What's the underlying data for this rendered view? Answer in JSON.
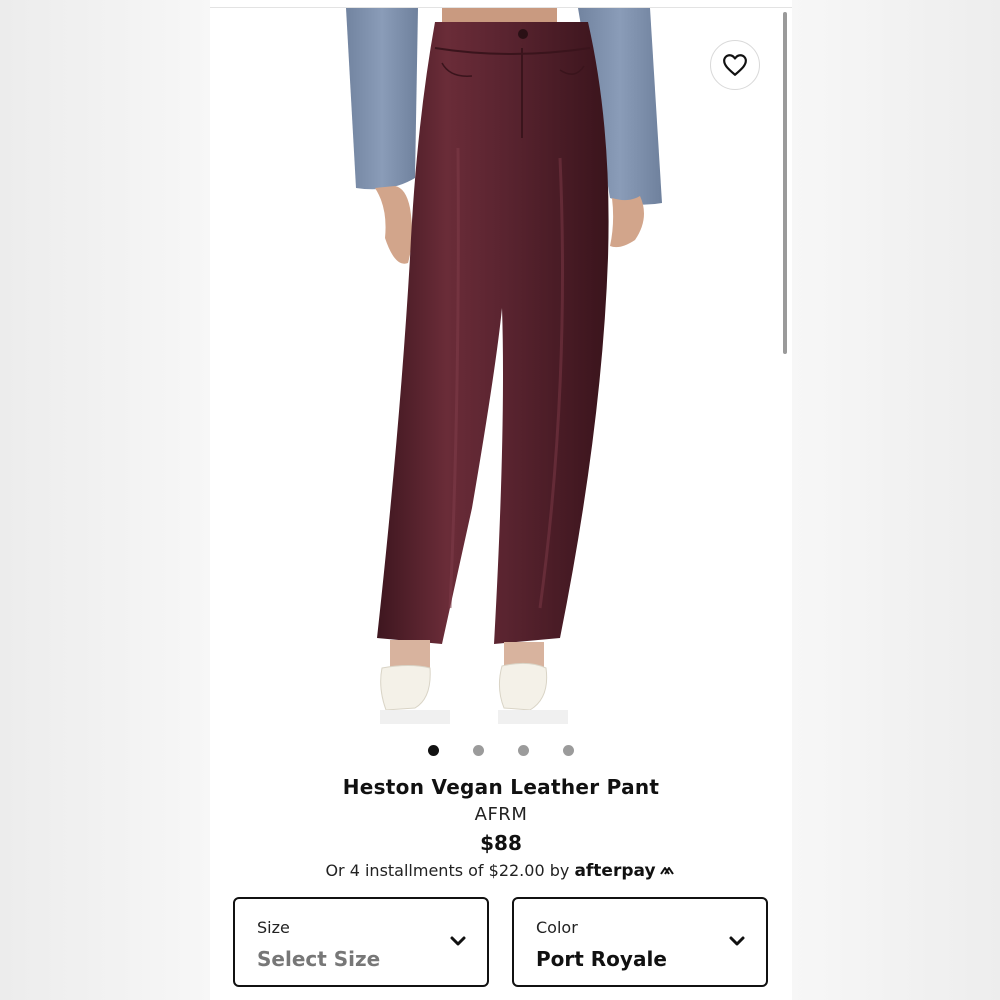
{
  "product": {
    "title": "Heston Vegan Leather Pant",
    "brand": "AFRM",
    "price": "$88",
    "installments_text": "Or 4 installments of $22.00 by",
    "afterpay_label": "afterpay"
  },
  "carousel": {
    "total": 4,
    "active_index": 0
  },
  "size_select": {
    "label": "Size",
    "value": "Select Size"
  },
  "color_select": {
    "label": "Color",
    "value": "Port Royale"
  },
  "colors": {
    "pant": "#5a2430",
    "shirt": "#8094b1",
    "accent": "#111111"
  },
  "icons": {
    "favorite": "heart-outline-icon",
    "dropdown": "chevron-down-icon",
    "afterpay": "afterpay-arrows-icon"
  }
}
